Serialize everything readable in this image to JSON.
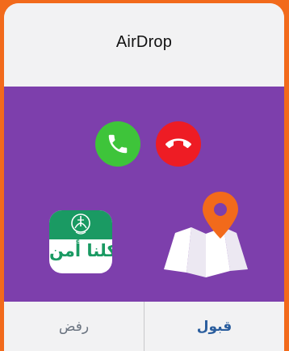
{
  "dialog": {
    "title": "AirDrop"
  },
  "content": {
    "background_color": "#7d3fac",
    "accept_call_color": "#3ec43a",
    "decline_call_color": "#ee1c24",
    "app_icon": {
      "name": "كلنا أمن",
      "brand_color": "#1a9a63"
    },
    "map_icon": {
      "pin_color": "#f26a1b"
    }
  },
  "footer": {
    "decline_label": "رفض",
    "accept_label": "قبول"
  }
}
